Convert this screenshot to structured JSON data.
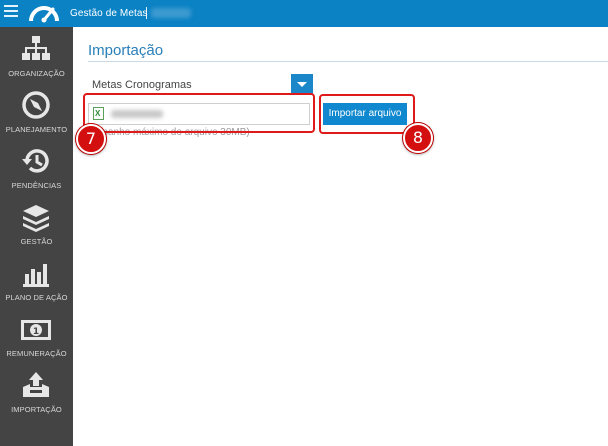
{
  "header": {
    "title": "Gestão de Metas",
    "separator": "|",
    "menu_icon": "hamburger-icon",
    "logo_icon": "gauge-logo-icon",
    "background": "#0a82c4"
  },
  "sidebar": {
    "background": "#444444",
    "items": [
      {
        "label": "ORGANIZAÇÃO",
        "icon": "org-chart-icon"
      },
      {
        "label": "PLANEJAMENTO",
        "icon": "compass-icon"
      },
      {
        "label": "PENDÊNCIAS",
        "icon": "history-icon"
      },
      {
        "label": "GESTÃO",
        "icon": "layers-icon"
      },
      {
        "label": "PLANO DE AÇÃO",
        "icon": "bar-chart-icon"
      },
      {
        "label": "REMUNERAÇÃO",
        "icon": "banknote-icon"
      },
      {
        "label": "IMPORTAÇÃO",
        "icon": "upload-tray-icon"
      }
    ]
  },
  "main": {
    "title": "Importação",
    "type_select": {
      "value": "Metas Cronogramas"
    },
    "file_input": {
      "file_icon": "excel-file-icon",
      "file_type_letter": "X"
    },
    "size_note": "(tamanho máximo do arquivo 30MB)",
    "import_button": "Importar arquivo"
  },
  "annotations": {
    "badge_7": "7",
    "badge_8": "8",
    "highlight_color": "#e01a1a"
  }
}
